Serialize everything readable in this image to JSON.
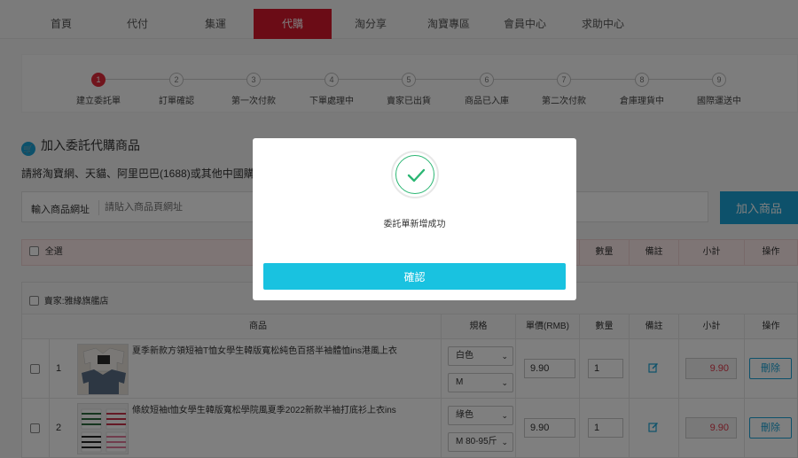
{
  "nav": {
    "items": [
      "首頁",
      "代付",
      "集運",
      "代購",
      "淘分享",
      "淘寶專區",
      "會員中心",
      "求助中心"
    ],
    "active_index": 3
  },
  "steps": [
    {
      "num": "1",
      "label": "建立委託單"
    },
    {
      "num": "2",
      "label": "訂單確認"
    },
    {
      "num": "3",
      "label": "第一次付款"
    },
    {
      "num": "4",
      "label": "下單處理中"
    },
    {
      "num": "5",
      "label": "賣家已出貨"
    },
    {
      "num": "6",
      "label": "商品已入庫"
    },
    {
      "num": "7",
      "label": "第二次付款"
    },
    {
      "num": "8",
      "label": "倉庫理貨中"
    },
    {
      "num": "9",
      "label": "國際運送中"
    }
  ],
  "section": {
    "title": "加入委託代購商品",
    "hint": "請將淘寶網、天貓、阿里巴巴(1688)或其他中國購物平"
  },
  "url_input": {
    "label": "輸入商品網址",
    "placeholder": "請貼入商品頁網址",
    "value": ""
  },
  "add_button": "加入商品",
  "summary_header": {
    "select_all": "全選",
    "product": "商品",
    "qty": "數量",
    "note": "備註",
    "subtotal": "小計",
    "action": "操作"
  },
  "store": {
    "name": "賣家:雅緣旗艦店",
    "columns": {
      "product": "商品",
      "spec": "規格",
      "unit_price": "單價(RMB)",
      "qty": "數量",
      "note": "備註",
      "subtotal": "小計",
      "action": "操作"
    },
    "rows": [
      {
        "index": "1",
        "name": "夏季新款方領短袖T恤女學生韓版寬松純色百搭半袖體恤ins港風上衣",
        "spec_color": "白色",
        "spec_size": "M",
        "price": "9.90",
        "qty": "1",
        "subtotal": "9.90",
        "delete_label": "刪除"
      },
      {
        "index": "2",
        "name": "條紋短袖t恤女學生韓版寬松學院風夏季2022新款半袖打底衫上衣ins",
        "spec_color": "綠色",
        "spec_size": "M 80-95斤",
        "price": "9.90",
        "qty": "1",
        "subtotal": "9.90",
        "delete_label": "刪除"
      }
    ]
  },
  "modal": {
    "message": "委託單新增成功",
    "confirm": "確認"
  },
  "colors": {
    "brand_red": "#d7192d",
    "accent_blue": "#1aa3d6",
    "confirm_cyan": "#19c2e0",
    "success_green": "#2bb673",
    "price_red": "#e0394a"
  }
}
